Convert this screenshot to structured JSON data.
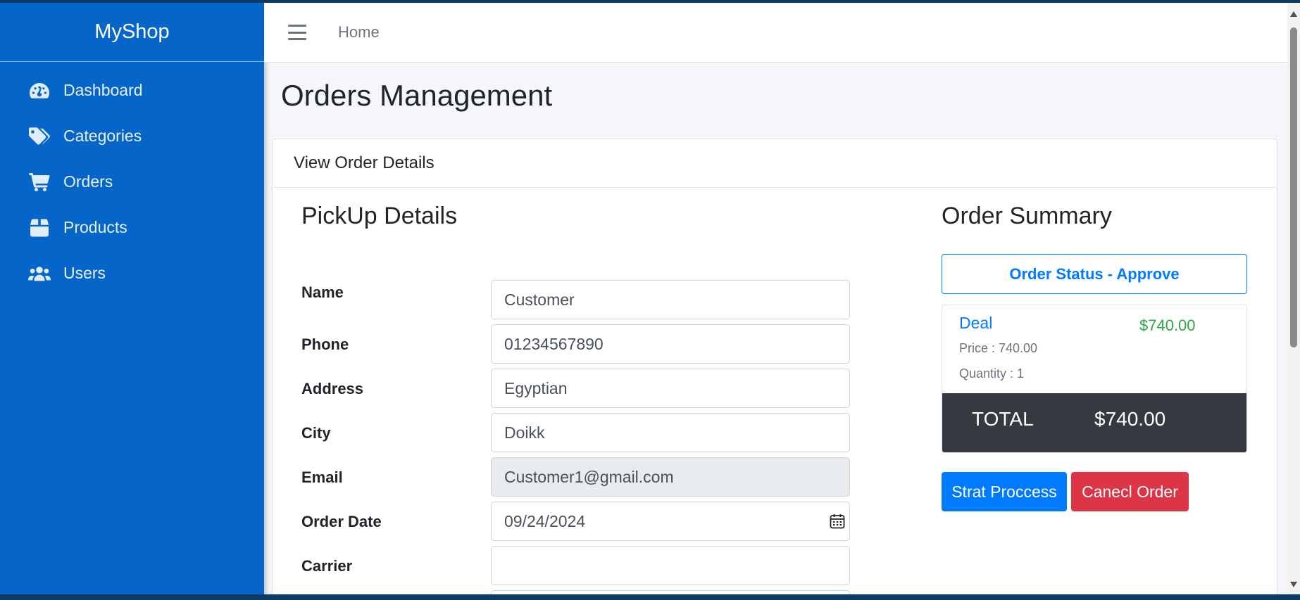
{
  "sidebar": {
    "brand": "MyShop",
    "items": [
      {
        "label": "Dashboard",
        "icon": "tachometer-icon"
      },
      {
        "label": "Categories",
        "icon": "tags-icon"
      },
      {
        "label": "Orders",
        "icon": "cart-icon"
      },
      {
        "label": "Products",
        "icon": "box-icon"
      },
      {
        "label": "Users",
        "icon": "users-icon"
      }
    ]
  },
  "topbar": {
    "home_label": "Home"
  },
  "page": {
    "title": "Orders Management",
    "card_header": "View Order Details"
  },
  "pickup": {
    "title": "PickUp Details",
    "fields": [
      {
        "label": "Name",
        "value": "Customer"
      },
      {
        "label": "Phone",
        "value": "01234567890"
      },
      {
        "label": "Address",
        "value": "Egyptian"
      },
      {
        "label": "City",
        "value": "Doikk"
      },
      {
        "label": "Email",
        "value": "Customer1@gmail.com"
      },
      {
        "label": "Order Date",
        "value": "09/24/2024"
      },
      {
        "label": "Carrier",
        "value": ""
      }
    ]
  },
  "summary": {
    "title": "Order Summary",
    "status": "Order Status - Approve",
    "item": {
      "name": "Deal",
      "price": "Price : 740.00",
      "quantity": "Quantity : 1",
      "amount": "$740.00"
    },
    "total_label": "TOTAL",
    "total_value": "$740.00",
    "buttons": {
      "start": "Strat Proccess",
      "cancel": "Canecl Order"
    }
  },
  "colors": {
    "sidebar": "#0665c8",
    "primary": "#007bff",
    "danger": "#dc3545",
    "success": "#28a745",
    "dark": "#343a40"
  }
}
